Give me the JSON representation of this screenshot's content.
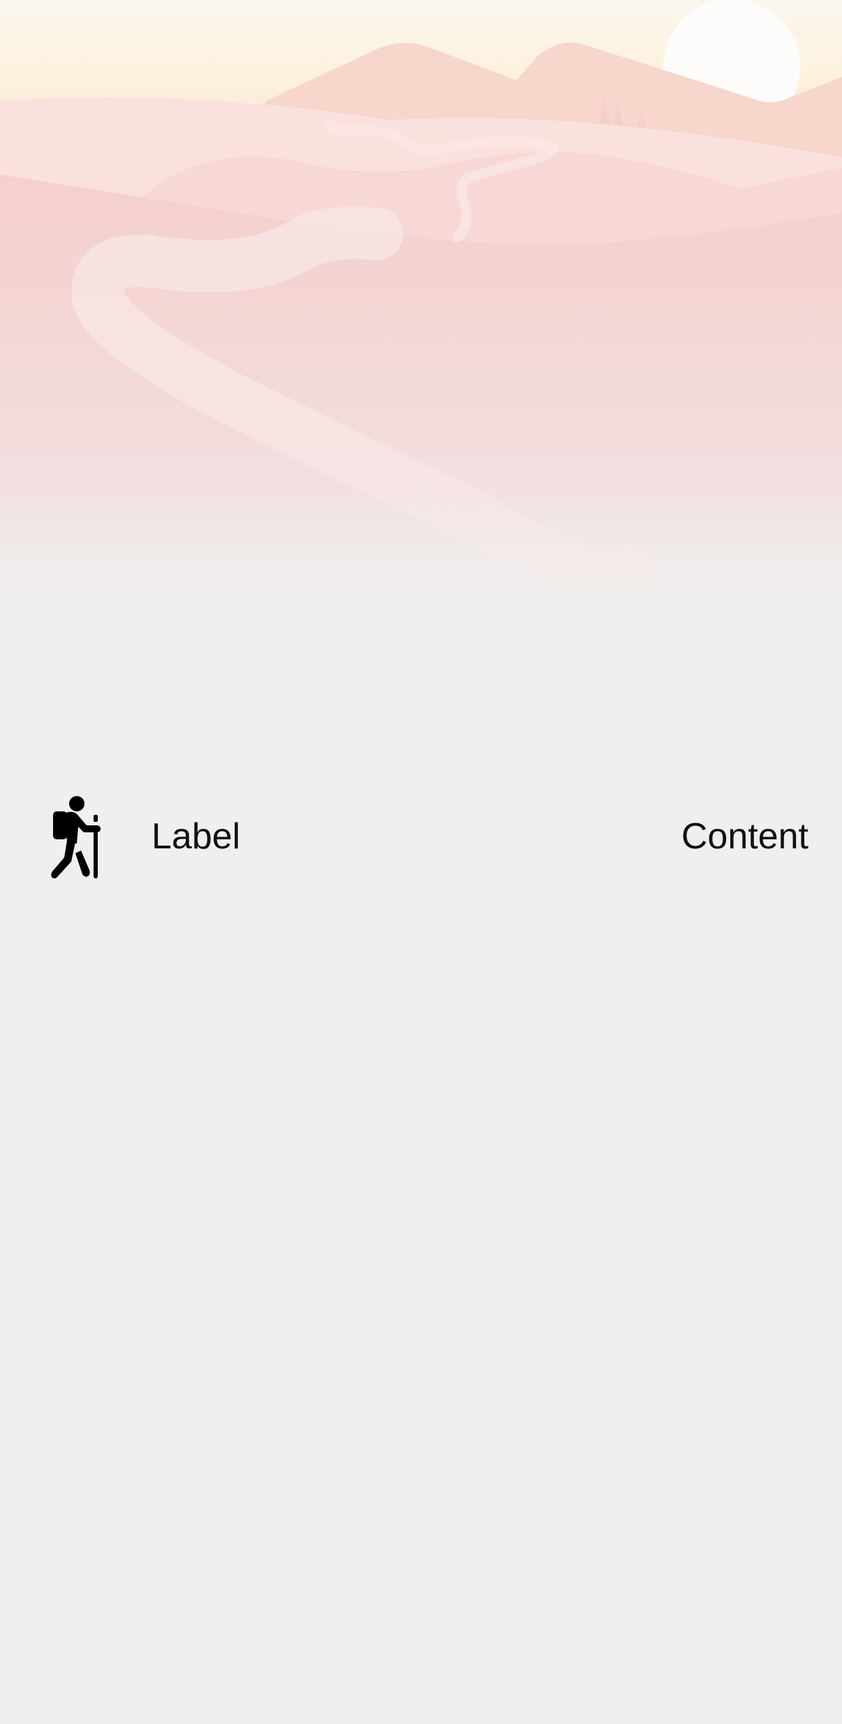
{
  "hero": {
    "scene": "mountain-landscape-illustration",
    "colors": {
      "sky_top": "#faf6ee",
      "sky_warm": "#fdf1dc",
      "mountain_back": "#f8d9cd",
      "hill_pink": "#f6d1d0",
      "path": "#f7e6e4",
      "fade_to": "#efefef",
      "sun": "#ffffff"
    }
  },
  "row": {
    "icon": "figure-hiking-icon",
    "label": "Label",
    "content": "Content"
  },
  "colors": {
    "background": "#efefef",
    "text": "#111111"
  }
}
